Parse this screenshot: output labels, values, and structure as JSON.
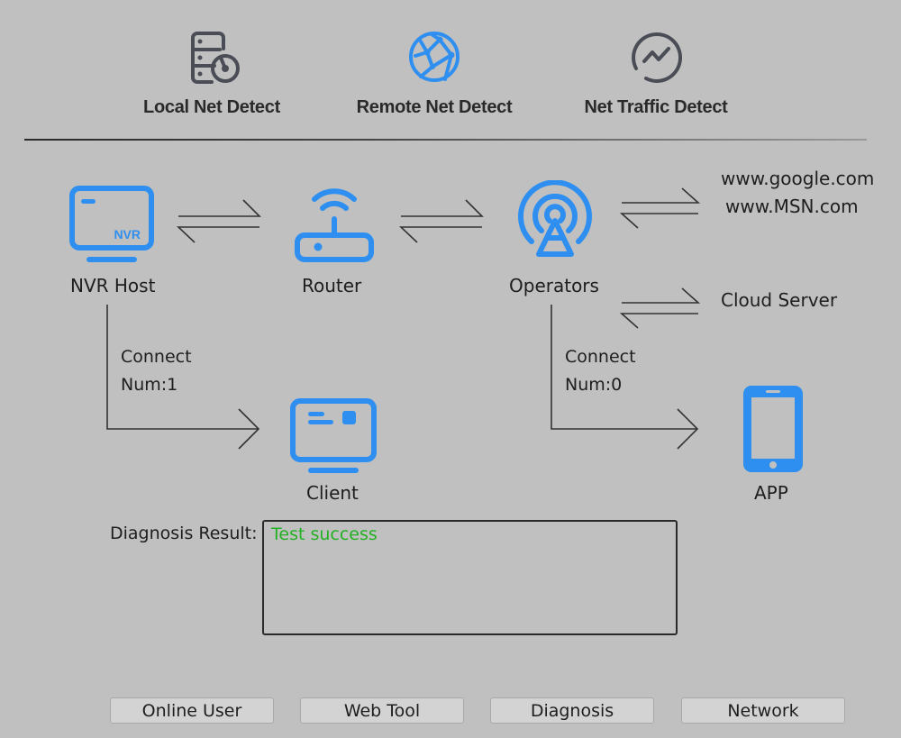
{
  "tabs": [
    {
      "label": "Local Net Detect",
      "icon": "server-gauge-icon",
      "active": false
    },
    {
      "label": "Remote Net Detect",
      "icon": "globe-network-icon",
      "active": true
    },
    {
      "label": "Net Traffic Detect",
      "icon": "traffic-wave-icon",
      "active": false
    }
  ],
  "colors": {
    "accent": "#2e8ff0",
    "inactive_icon": "#4a4d55",
    "success": "#23b023",
    "background": "#c0c0c0"
  },
  "diagram": {
    "nvr_host": {
      "label": "NVR Host",
      "badge": "NVR"
    },
    "router": {
      "label": "Router"
    },
    "operators": {
      "label": "Operators"
    },
    "destinations": {
      "line1": "www.google.com",
      "line2": "www.MSN.com"
    },
    "cloud": {
      "label": "Cloud Server"
    },
    "client": {
      "label": "Client",
      "connect_line1": "Connect",
      "connect_line2": "Num:1"
    },
    "app": {
      "label": "APP",
      "connect_line1": "Connect",
      "connect_line2": "Num:0"
    }
  },
  "diagnosis": {
    "label": "Diagnosis Result:",
    "result": "Test success"
  },
  "buttons": {
    "online_user": "Online User",
    "web_tool": "Web Tool",
    "diagnosis": "Diagnosis",
    "network": "Network"
  }
}
